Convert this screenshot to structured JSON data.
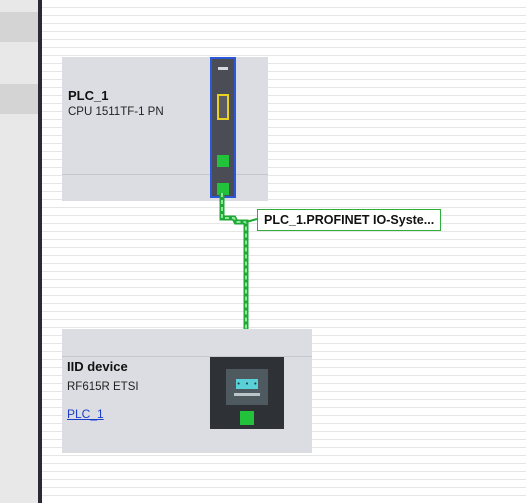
{
  "plc_device": {
    "name": "PLC_1",
    "type": "CPU 1511TF-1 PN"
  },
  "io_device": {
    "name": "IID device",
    "type": "RF615R ETSI",
    "link": "PLC_1",
    "icon_text": "• • •"
  },
  "network": {
    "label": "PLC_1.PROFINET IO-Syste..."
  },
  "colors": {
    "network_line": "#22c33a",
    "selection_border": "#2c58d8",
    "module_highlight": "#e9d021"
  }
}
